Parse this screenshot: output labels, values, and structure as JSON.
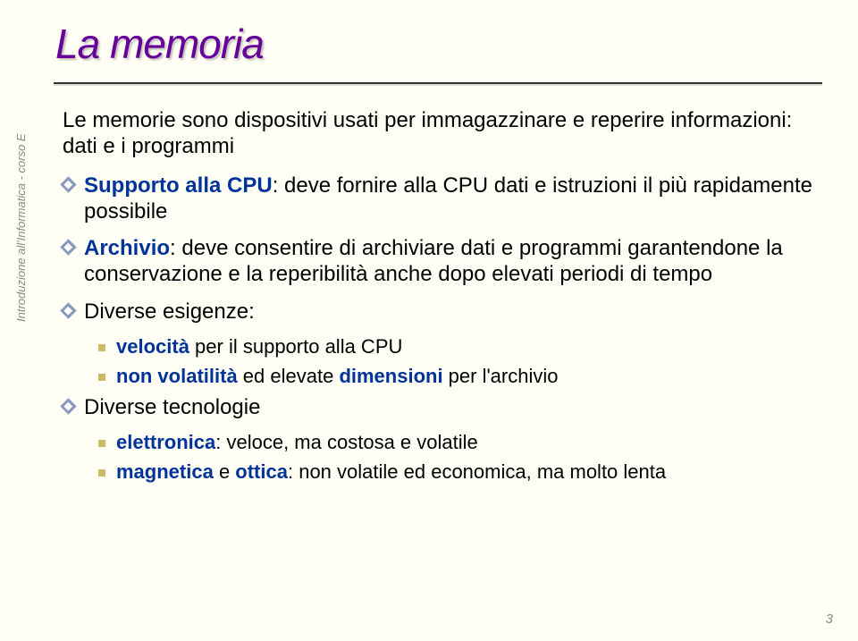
{
  "sidebar": "Introduzione all'Informatica - corso E",
  "title": "La memoria",
  "intro": "Le memorie sono dispositivi usati per immagazzinare e reperire informazioni: dati e i programmi",
  "b1_a": "Supporto alla CPU",
  "b1_b": ": deve fornire alla CPU dati e istruzioni il più rapidamente possibile",
  "b2_a": "Archivio",
  "b2_b": ": deve consentire di archiviare dati e programmi garantendone la conservazione e la reperibilità anche dopo elevati periodi di tempo",
  "b3": "Diverse esigenze:",
  "b3_1_a": "velocità",
  "b3_1_b": " per il supporto alla CPU",
  "b3_2_a": "non volatilità",
  "b3_2_b": " ed elevate ",
  "b3_2_c": "dimensioni",
  "b3_2_d": " per l'archivio",
  "b4": "Diverse tecnologie",
  "b4_1_a": "elettronica",
  "b4_1_b": ": veloce, ma costosa e volatile",
  "b4_2_a": "magnetica",
  "b4_2_b": " e ",
  "b4_2_c": "ottica",
  "b4_2_d": ": non volatile ed economica, ma molto lenta",
  "page": "3"
}
